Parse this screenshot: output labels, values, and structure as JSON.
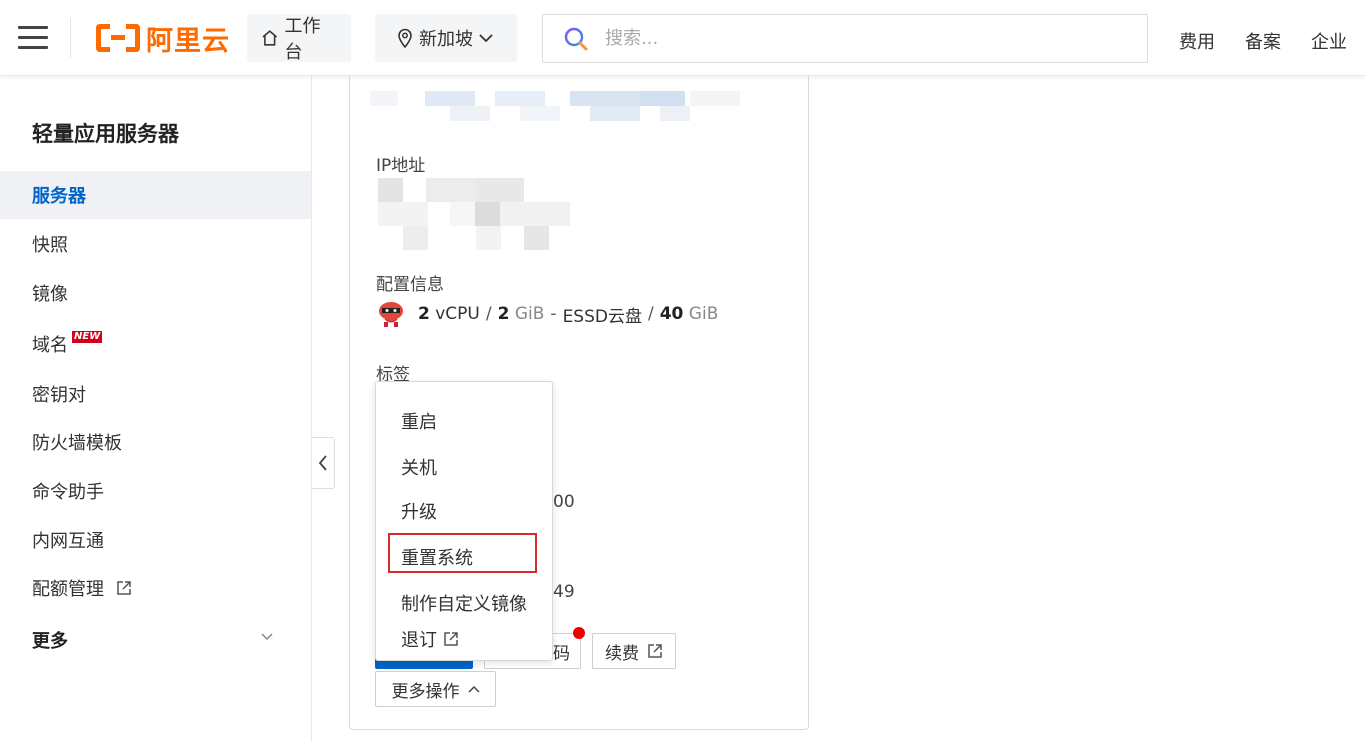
{
  "header": {
    "brand": "阿里云",
    "workbench_label": "工作台",
    "region_label": "新加坡",
    "search_placeholder": "搜索...",
    "links": [
      "费用",
      "备案",
      "企业"
    ]
  },
  "sidebar": {
    "title": "轻量应用服务器",
    "items": [
      {
        "label": "服务器",
        "active": true
      },
      {
        "label": "快照"
      },
      {
        "label": "镜像"
      },
      {
        "label": "域名",
        "badge": "NEW"
      },
      {
        "label": "密钥对"
      },
      {
        "label": "防火墙模板"
      },
      {
        "label": "命令助手"
      },
      {
        "label": "内网互通"
      },
      {
        "label": "配额管理",
        "icon": "external-link-icon"
      },
      {
        "label": "更多",
        "icon": "chevron-down-icon"
      }
    ]
  },
  "card": {
    "ip_label": "IP地址",
    "config_label": "配置信息",
    "config": {
      "cpu_num": "2",
      "cpu_unit": "vCPU",
      "mem_num": "2",
      "mem_unit": "GiB",
      "disk_type": "ESSD云盘",
      "disk_num": "40",
      "disk_unit": "GiB"
    },
    "tags_label": "标签",
    "partial_value_1": "00",
    "partial_value_2": "49",
    "buttons": {
      "reset_password_partial": "码",
      "renew": "续费",
      "more_actions": "更多操作"
    }
  },
  "dropdown": {
    "items": [
      "重启",
      "关机",
      "升级",
      "重置系统",
      "制作自定义镜像",
      "退订"
    ],
    "highlighted": "重置系统"
  },
  "colors": {
    "brand": "#ff6a00",
    "primary": "#0064c8",
    "highlight_border": "#d62b2b"
  }
}
